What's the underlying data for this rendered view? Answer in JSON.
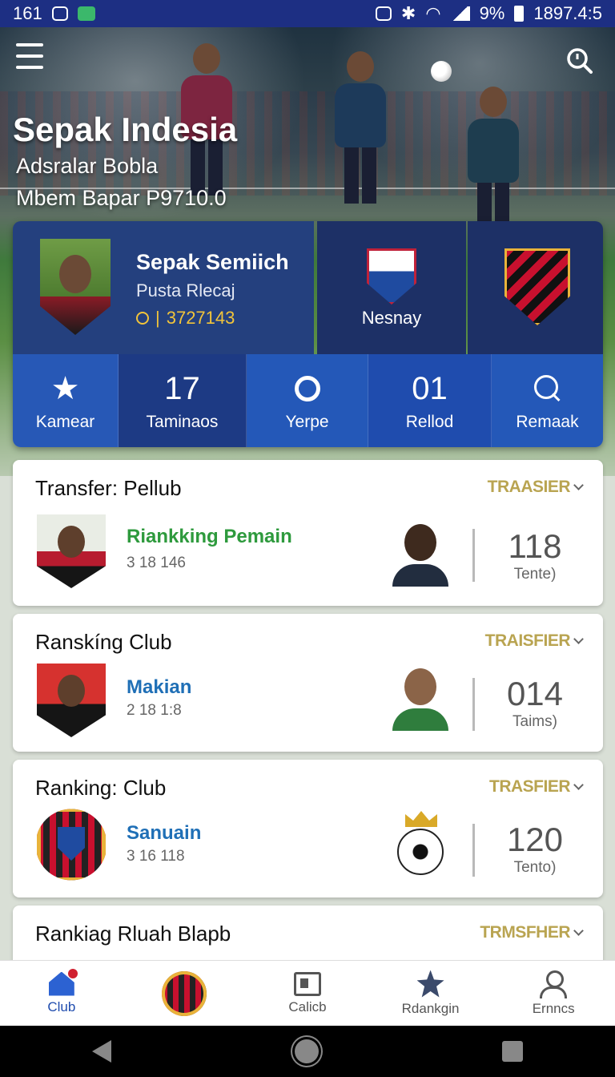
{
  "status_bar": {
    "left_text": "161",
    "right_text": "9%",
    "time": "1897.4:5"
  },
  "hero": {
    "title": "Sepak Indesia",
    "subtitle1": "Adsralar Bobla",
    "subtitle2": "Mbem Bapar P9710.0"
  },
  "profile": {
    "name": "Sepak Semiich",
    "sub": "Pusta Rlecaj",
    "score": "3727143"
  },
  "clubs": {
    "club_a_label": "Nesnay"
  },
  "stats": [
    {
      "value": "",
      "label": "Kamear",
      "icon": "star-icon"
    },
    {
      "value": "17",
      "label": "Taminaos"
    },
    {
      "value": "",
      "label": "Yerpe",
      "icon": "ring-icon"
    },
    {
      "value": "01",
      "label": "Rellod"
    },
    {
      "value": "",
      "label": "Remaak",
      "icon": "search-icon"
    }
  ],
  "cards": [
    {
      "title": "Transfer: Pellub",
      "tag": "TRAASIER",
      "name": "Riankking Pemain",
      "name_color": "#2e9a3d",
      "meta": "3 18 146",
      "number": "118",
      "number_label": "Tente)"
    },
    {
      "title": "Ranskíng Club",
      "tag": "TRAISFIER",
      "name": "Makian",
      "name_color": "#1f6fb6",
      "meta": "2 18 1:8",
      "number": "014",
      "number_label": "Taims)"
    },
    {
      "title": "Ranking: Club",
      "tag": "TRASFIER",
      "name": "Sanuain",
      "name_color": "#1f6fb6",
      "meta": "3 16 118",
      "number": "120",
      "number_label": "Tento)"
    },
    {
      "title": "Rankiag Rluah Blapb",
      "tag": "TRMSFHER"
    }
  ],
  "bottom_nav": [
    {
      "label": "Club",
      "icon": "home-icon",
      "active": true
    },
    {
      "label": "",
      "icon": "club-badge-icon"
    },
    {
      "label": "Calicb",
      "icon": "news-icon"
    },
    {
      "label": "Rdankgin",
      "icon": "ranking-star-icon"
    },
    {
      "label": "Ernncs",
      "icon": "user-icon"
    }
  ],
  "colors": {
    "primary_blue": "#1f4cae",
    "accent_gold": "#b9a451",
    "status_bar": "#1d2f83"
  }
}
